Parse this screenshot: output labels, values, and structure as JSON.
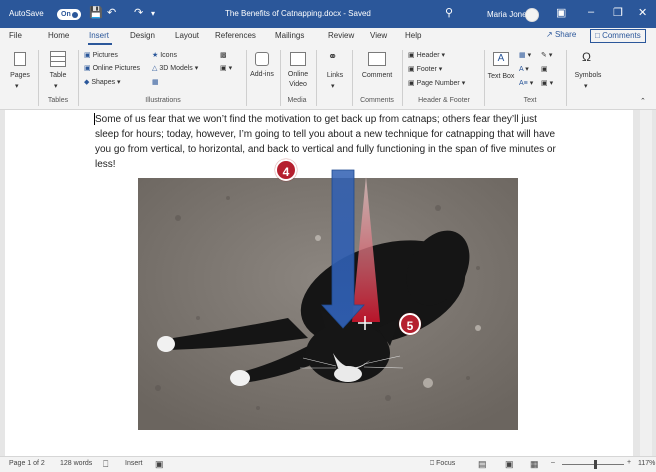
{
  "titlebar": {
    "autosave_label": "AutoSave",
    "autosave_state": "On",
    "doc_title": "The Benefits of Catnapping.docx - Saved",
    "user_name": "Maria Jones"
  },
  "tabs": [
    {
      "label": "File"
    },
    {
      "label": "Home"
    },
    {
      "label": "Insert"
    },
    {
      "label": "Design"
    },
    {
      "label": "Layout"
    },
    {
      "label": "References"
    },
    {
      "label": "Mailings"
    },
    {
      "label": "Review"
    },
    {
      "label": "View"
    },
    {
      "label": "Help"
    }
  ],
  "active_tab": "Insert",
  "share_label": "Share",
  "comments_label": "Comments",
  "ribbon": {
    "pages": "Pages",
    "table": "Table",
    "tables_group": "Tables",
    "pictures": "Pictures",
    "online_pictures": "Online Pictures",
    "shapes": "Shapes",
    "icons": "Icons",
    "models_3d": "3D Models",
    "illustrations_group": "Illustrations",
    "addins": "Add-ins",
    "online_video": "Online Video",
    "media_group": "Media",
    "links": "Links",
    "comment": "Comment",
    "comments_group": "Comments",
    "header": "Header",
    "footer": "Footer",
    "page_number": "Page Number",
    "header_footer_group": "Header & Footer",
    "text_box": "Text Box",
    "text_group": "Text",
    "symbols": "Symbols"
  },
  "document": {
    "paragraph": "Some of us fear that we won’t find the motivation to get back up from catnaps; others fear they’ll just sleep for hours; today, however, I’m going to tell you about a new technique for catnapping that will have you go from vertical, to horizontal, and back to vertical and fully functioning in the span of five minutes or less!"
  },
  "callouts": {
    "step_a": "4",
    "step_b": "5"
  },
  "statusbar": {
    "page": "Page 1 of 2",
    "words": "128 words",
    "mode": "Insert",
    "focus": "Focus",
    "zoom": "117%"
  },
  "colors": {
    "accent": "#2b579a",
    "callout": "#b5202f"
  }
}
